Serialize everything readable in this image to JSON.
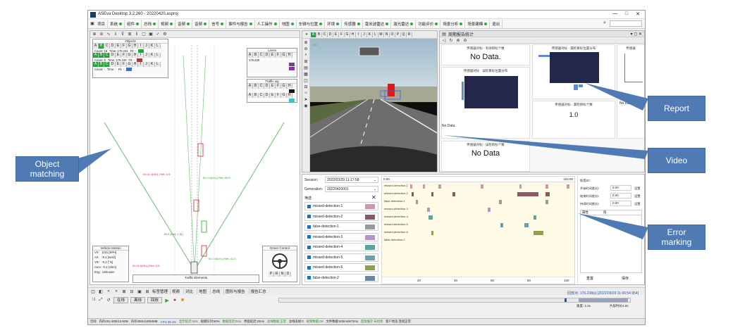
{
  "window": {
    "title": "ASEva Desktop 3.2.260 - 20220420.asproj",
    "controls": [
      "—",
      "□",
      "✕"
    ]
  },
  "menu": {
    "items": [
      {
        "label": "项目",
        "dot": false
      },
      {
        "label": "系统",
        "dot": true
      },
      {
        "label": "组件",
        "dot": true
      },
      {
        "label": "总线",
        "dot": true
      },
      {
        "label": "视频",
        "dot": true
      },
      {
        "label": "音频",
        "dot": true
      },
      {
        "label": "音频",
        "dot": true
      },
      {
        "label": "信号",
        "dot": true
      },
      {
        "label": "事件与报告",
        "dot": true
      },
      {
        "label": "人工操作",
        "dot": true
      },
      {
        "label": "地图",
        "dot": true
      },
      {
        "label": "车辆与位置",
        "dot": true
      },
      {
        "label": "环境",
        "dot": true
      },
      {
        "label": "传感器",
        "dot": true
      },
      {
        "label": "毫米波雷达",
        "dot": true
      },
      {
        "label": "激光雷达",
        "dot": true
      },
      {
        "label": "功能评价",
        "dot": true
      },
      {
        "label": "场景分析",
        "dot": true
      },
      {
        "label": "场景建模",
        "dot": true
      },
      {
        "label": "退出",
        "dot": false
      }
    ]
  },
  "object_panel": {
    "objects_title": "Objects",
    "lanes_title": "Lanes",
    "traffic_title": "Traffic sig",
    "letters": [
      "A",
      "B",
      "C",
      "D",
      "E",
      "F",
      "G",
      "H",
      "I",
      "J",
      "K",
      "L"
    ],
    "count_rows": [
      {
        "count": "Count: 16",
        "time": "Time: 176.231",
        "fit": "Fit: -"
      },
      {
        "count": "Count: 8",
        "time": "Time: 176.240",
        "fit": "Fit: -"
      },
      {
        "count": "Count: -",
        "time": "Time: -",
        "fit": "Fit: -"
      }
    ],
    "lanes_value": "176.230",
    "vehicle_motion": {
      "title": "Vehicle Motion",
      "rows": [
        "VX:   1161 [KPH]",
        "AX:   -0.1 [m/s2]",
        "YR:   -0.2 [°/s]",
        "Curv: -0.1 [1/km]",
        "Eng:  Unknown"
      ]
    },
    "traffic_elements": "Traffic Elements",
    "driver_control": "Driver Control",
    "gear_letters": [
      "P",
      "R",
      "N",
      "D"
    ]
  },
  "video_panel": {
    "letters": [
      "A",
      "B",
      "C",
      "D",
      "E",
      "F",
      "G",
      "H",
      "I",
      "J",
      "K",
      "L",
      "M",
      "N",
      "O",
      "P",
      "Q",
      "R"
    ]
  },
  "report_panel": {
    "title": "周期报告统计",
    "cards": [
      {
        "title": "传感器对标 - 有效目标个数",
        "value": "No Data."
      },
      {
        "title": "传感器对标 - 漏检目标位置分布"
      },
      {
        "title": "传感器对标 - 误检目标位置分布",
        "value": "No Data."
      },
      {
        "title": "传感器对标 - 漏检目标个数",
        "value": "1.0"
      },
      {
        "title": "传感器对标 - 误检目标个数",
        "value": "No Data"
      },
      {
        "title": "传感器",
        "value": "No Data."
      }
    ]
  },
  "error_panel": {
    "session_label": "Session:",
    "session_value": "2022/03/29 11:17:58",
    "generation_label": "Generation:",
    "generation_value": "20220420001",
    "filter_label": "筛选",
    "rows": [
      {
        "label": "missed-detection-1",
        "color": "#c99aaa"
      },
      {
        "label": "missed-detection-2",
        "color": "#8a5a64"
      },
      {
        "label": "false-detection-1",
        "color": "#9a9a9a"
      },
      {
        "label": "missed-detection-3",
        "color": "#b793c7"
      },
      {
        "label": "missed-detection-4",
        "color": "#5aa59a"
      },
      {
        "label": "missed-detection-5",
        "color": "#6aa0b0"
      },
      {
        "label": "missed-detection-6",
        "color": "#8da04a"
      },
      {
        "label": "false-detection-2",
        "color": "#6a88a6"
      }
    ],
    "timeline_start": "0.00",
    "timeline_end": "103.00",
    "timeline_ticks": [
      "20",
      "40",
      "60",
      "80",
      "100"
    ],
    "right_labels": {
      "tag_id": "标签ID：",
      "f1": "开始时间差(s)：",
      "f2": "结束时间差(s)：",
      "f3": "持续时间差(s)：",
      "v1": "0.00",
      "v2": "0.00",
      "v3": "0.00",
      "btn": "设置",
      "col1": "属性",
      "col2": "值",
      "reset": "重置",
      "save": "保存"
    }
  },
  "bottom": {
    "tabs_label": "标签管理",
    "tabs": [
      "视频",
      "对比",
      "地图",
      "总线",
      "图形与报告",
      "报告汇总"
    ],
    "mode_buttons": [
      "在线",
      "离线",
      "回放"
    ],
    "right_info": "回放点: 176.238(s) [2022/03/29 11:00:54.954]",
    "speed": "速度: 1.0x",
    "range": "片段时长4.0s"
  },
  "status": [
    "空闲",
    "内存451.4GB/13.9GB",
    "内存4591/16384MB",
    "CPU 35.1%",
    "显示延迟:0ms",
    "视频队列:50%",
    "数据延迟:0ms",
    "界面延迟:20ms",
    "总线数据:正常",
    "总线丢帧:0",
    "视频数据:Ok",
    "文件数据:625ms/872ms",
    "回放缓存:未找到",
    "客户状态:连接正常"
  ],
  "callouts": {
    "report": "Report",
    "video": "Video",
    "object_matching": "Object\nmatching",
    "error_marking": "Error\nmarking"
  }
}
